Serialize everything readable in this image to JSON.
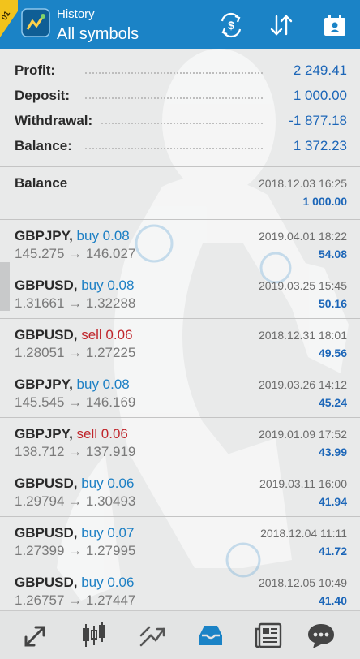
{
  "header": {
    "title": "History",
    "subtitle": "All symbols",
    "icons": [
      "app-logo-icon",
      "currency-exchange-icon",
      "sort-icon",
      "calendar-icon"
    ]
  },
  "summary": [
    {
      "label": "Profit:",
      "value": "2 249.41"
    },
    {
      "label": "Deposit:",
      "value": "1 000.00"
    },
    {
      "label": "Withdrawal:",
      "value": "-1 877.18"
    },
    {
      "label": "Balance:",
      "value": "1 372.23"
    }
  ],
  "balance_entry": {
    "label": "Balance",
    "time": "2018.12.03 16:25",
    "amount": "1 000.00"
  },
  "trades": [
    {
      "symbol": "GBPJPY,",
      "action": "buy 0.08",
      "side": "buy",
      "open": "145.275",
      "close": "146.027",
      "time": "2019.04.01 18:22",
      "profit": "54.08"
    },
    {
      "symbol": "GBPUSD,",
      "action": "buy 0.08",
      "side": "buy",
      "open": "1.31661",
      "close": "1.32288",
      "time": "2019.03.25 15:45",
      "profit": "50.16"
    },
    {
      "symbol": "GBPUSD,",
      "action": "sell 0.06",
      "side": "sell",
      "open": "1.28051",
      "close": "1.27225",
      "time": "2018.12.31 18:01",
      "profit": "49.56"
    },
    {
      "symbol": "GBPJPY,",
      "action": "buy 0.08",
      "side": "buy",
      "open": "145.545",
      "close": "146.169",
      "time": "2019.03.26 14:12",
      "profit": "45.24"
    },
    {
      "symbol": "GBPJPY,",
      "action": "sell 0.06",
      "side": "sell",
      "open": "138.712",
      "close": "137.919",
      "time": "2019.01.09 17:52",
      "profit": "43.99"
    },
    {
      "symbol": "GBPUSD,",
      "action": "buy 0.06",
      "side": "buy",
      "open": "1.29794",
      "close": "1.30493",
      "time": "2019.03.11 16:00",
      "profit": "41.94"
    },
    {
      "symbol": "GBPUSD,",
      "action": "buy 0.07",
      "side": "buy",
      "open": "1.27399",
      "close": "1.27995",
      "time": "2018.12.04 11:11",
      "profit": "41.72"
    },
    {
      "symbol": "GBPUSD,",
      "action": "buy 0.06",
      "side": "buy",
      "open": "1.26757",
      "close": "1.27447",
      "time": "2018.12.05 10:49",
      "profit": "41.40"
    }
  ],
  "arrow": "→",
  "bottom_nav": [
    "quotes-icon",
    "chart-icon",
    "trade-icon",
    "history-icon",
    "news-icon",
    "chat-icon"
  ],
  "colors": {
    "accent": "#1b83c6",
    "buy": "#1c7fc4",
    "sell": "#c0262c",
    "value": "#1c66b8",
    "active_tab": "#1b83c6"
  }
}
